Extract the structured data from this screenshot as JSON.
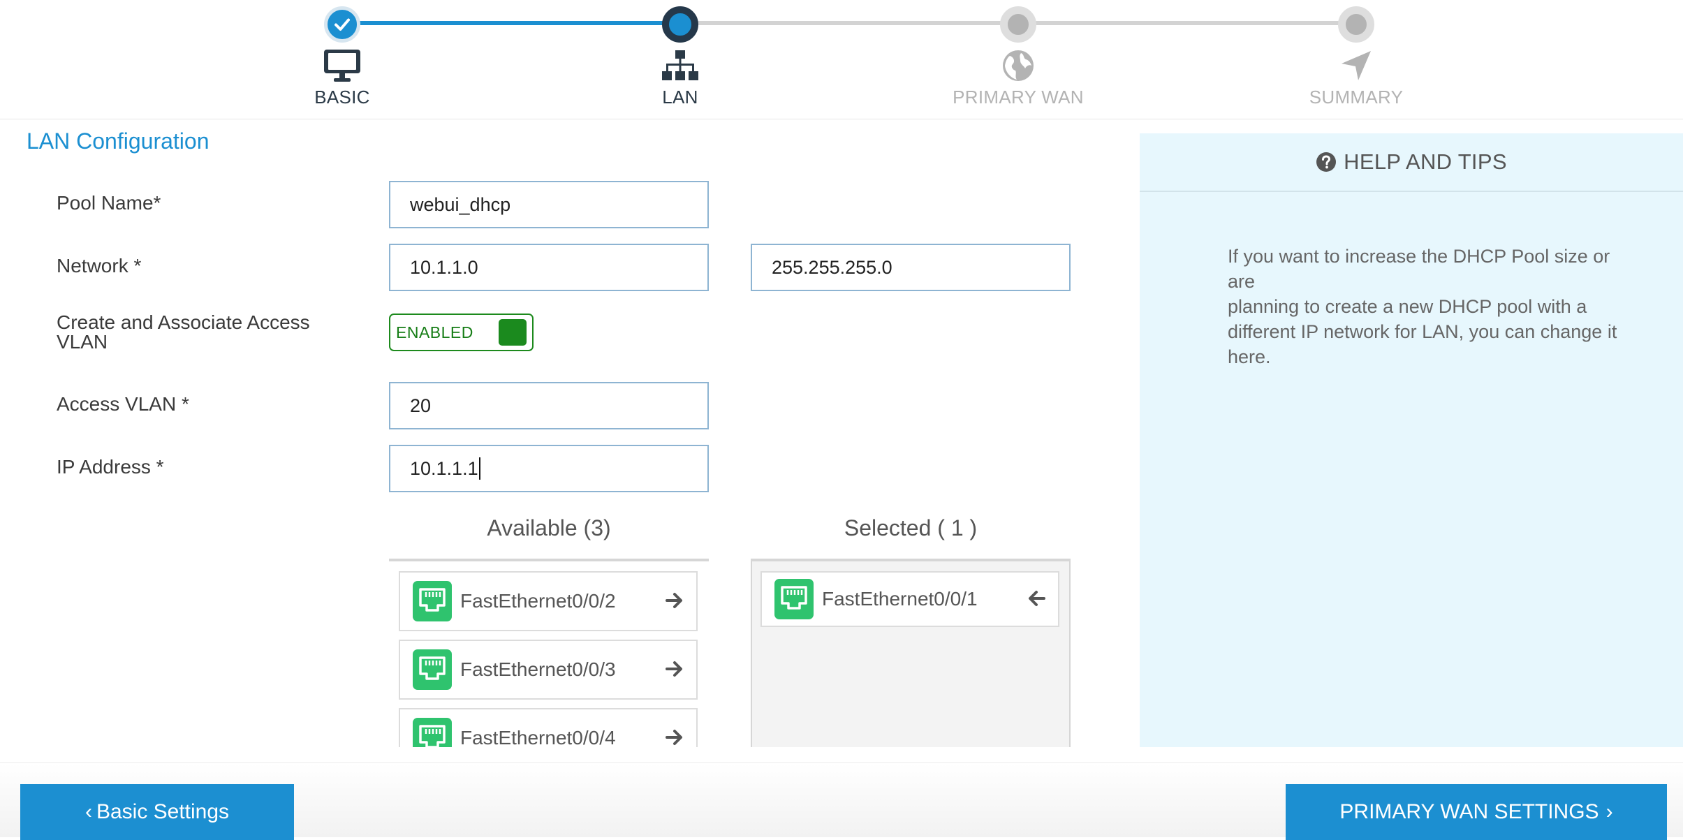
{
  "wizard": {
    "steps": [
      {
        "label": "BASIC",
        "state": "done"
      },
      {
        "label": "LAN",
        "state": "current"
      },
      {
        "label": "PRIMARY WAN",
        "state": "todo"
      },
      {
        "label": "SUMMARY",
        "state": "todo"
      }
    ]
  },
  "form": {
    "title": "LAN Configuration",
    "pool_name": {
      "label": "Pool Name*",
      "value": "webui_dhcp"
    },
    "network": {
      "label": "Network *",
      "value": "10.1.1.0",
      "mask": "255.255.255.0"
    },
    "vlan_toggle": {
      "label_line1": "Create and Associate Access",
      "label_line2": "VLAN",
      "state": "ENABLED"
    },
    "access_vlan": {
      "label": "Access VLAN *",
      "value": "20"
    },
    "ip_address": {
      "label": "IP Address *",
      "value": "10.1.1.1"
    }
  },
  "interfaces": {
    "available_title": "Available (3)",
    "selected_title": "Selected ( 1 )",
    "available": [
      "FastEthernet0/0/2",
      "FastEthernet0/0/3",
      "FastEthernet0/0/4"
    ],
    "selected": [
      "FastEthernet0/0/1"
    ]
  },
  "help": {
    "title": "HELP AND TIPS",
    "text_lines": [
      "If you want to increase the DHCP Pool size or are",
      "planning to create a new DHCP pool with a",
      "different IP network for LAN, you can change it",
      "here."
    ]
  },
  "footer": {
    "back_label": "Basic Settings",
    "next_label": "PRIMARY WAN SETTINGS"
  },
  "colors": {
    "accent": "#1b8fd1",
    "enabled_green": "#1b8a1e",
    "port_green": "#2fc36e",
    "help_bg": "#e7f7fd"
  }
}
